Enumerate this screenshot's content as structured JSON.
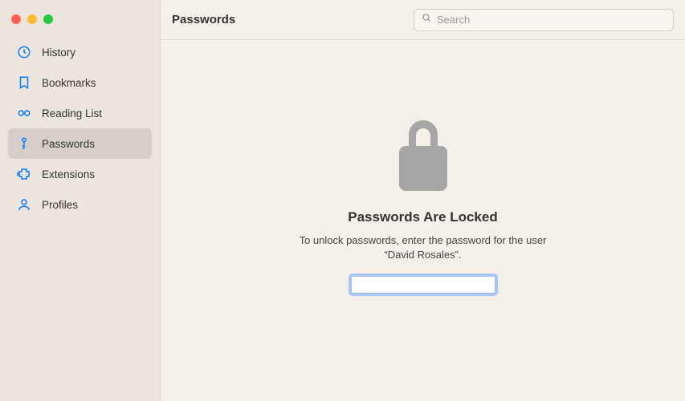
{
  "window": {
    "title": "Passwords"
  },
  "search": {
    "placeholder": "Search"
  },
  "sidebar": {
    "items": [
      {
        "label": "History",
        "icon": "clock-icon",
        "active": false
      },
      {
        "label": "Bookmarks",
        "icon": "bookmark-icon",
        "active": false
      },
      {
        "label": "Reading List",
        "icon": "glasses-icon",
        "active": false
      },
      {
        "label": "Passwords",
        "icon": "key-icon",
        "active": true
      },
      {
        "label": "Extensions",
        "icon": "puzzle-icon",
        "active": false
      },
      {
        "label": "Profiles",
        "icon": "person-icon",
        "active": false
      }
    ]
  },
  "locked": {
    "heading": "Passwords Are Locked",
    "message": "To unlock passwords, enter the password for the user “David Rosales”.",
    "value": ""
  }
}
